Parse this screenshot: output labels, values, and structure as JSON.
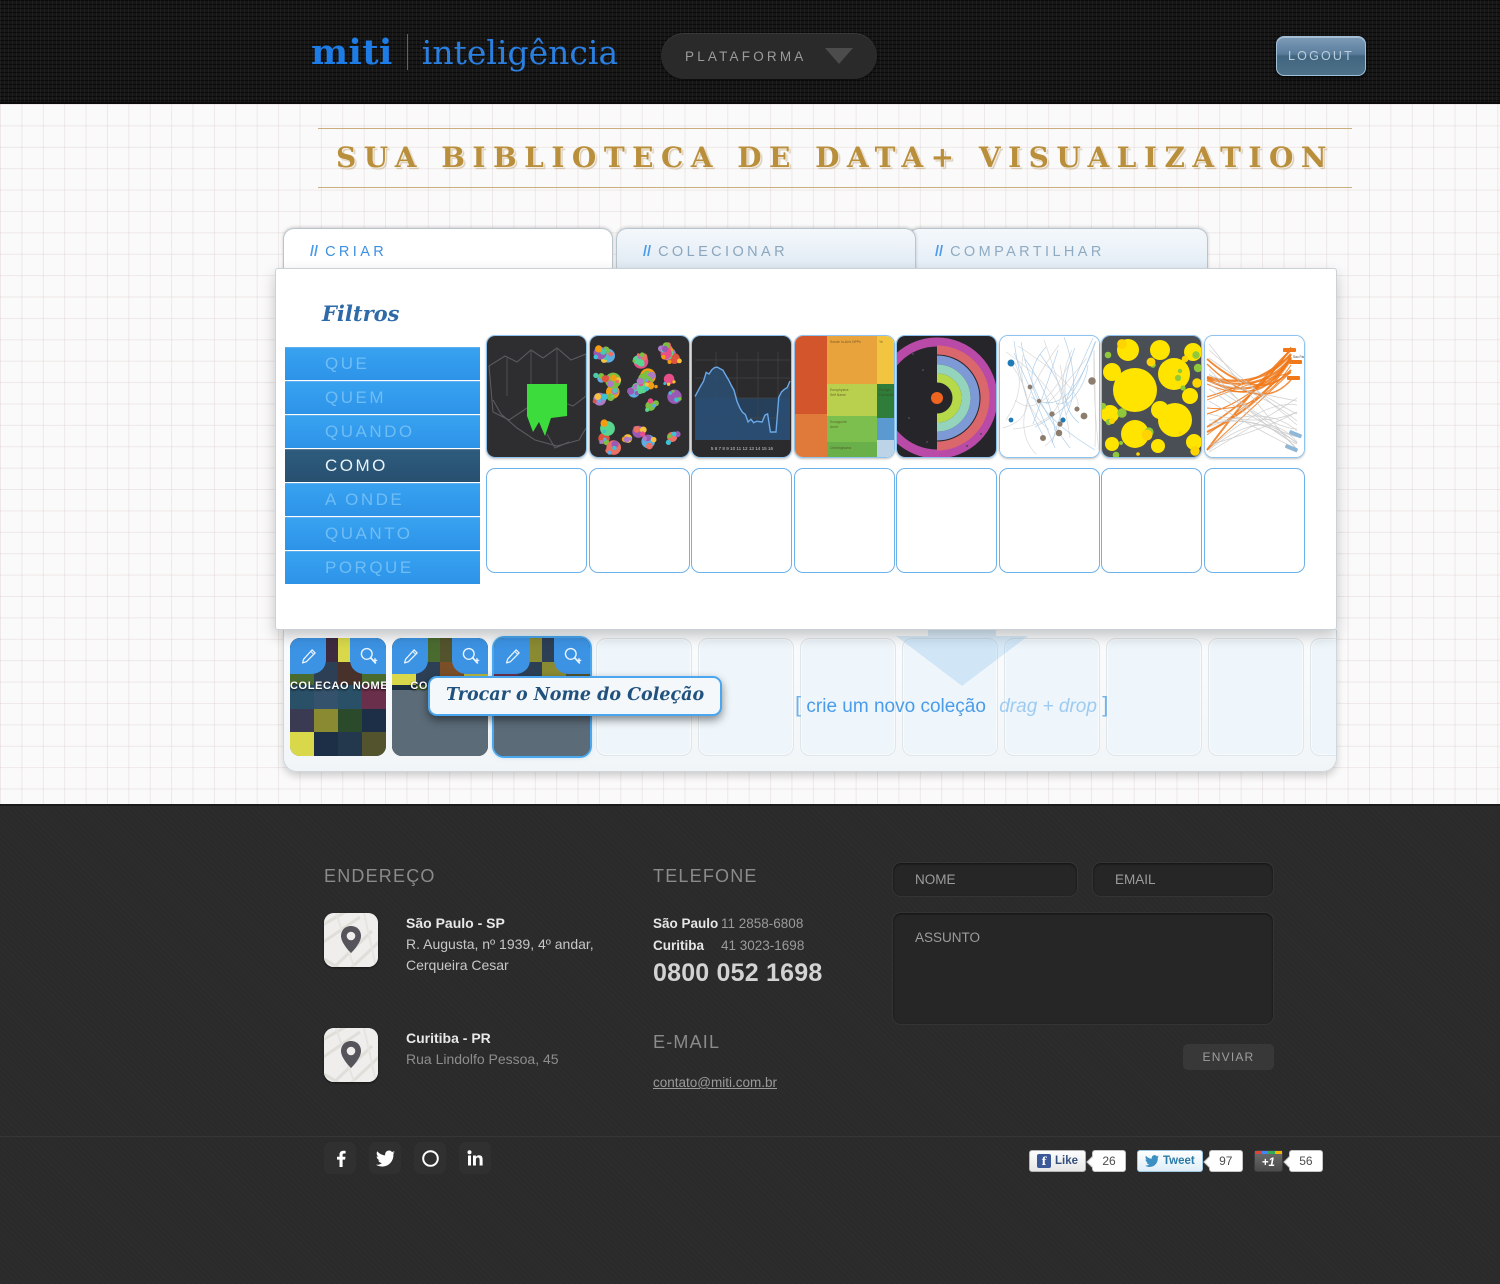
{
  "header": {
    "logo_main": "miti",
    "logo_sub": "inteligência",
    "platform_label": "PLATAFORMA",
    "platform_caret": "chevron-down-icon",
    "logout_label": "LOGOUT"
  },
  "tagline": "SUA BIBLIOTECA DE DATA+ VISUALIZATION",
  "tabs": [
    {
      "slashes": "//",
      "label": "CRIAR",
      "active": true
    },
    {
      "slashes": "//",
      "label": "COLECIONAR",
      "active": false
    },
    {
      "slashes": "//",
      "label": "COMPARTILHAR",
      "active": false
    }
  ],
  "panel": {
    "filters_title": "Filtros",
    "filters": [
      {
        "label": "QUE",
        "active": false
      },
      {
        "label": "QUEM",
        "active": false
      },
      {
        "label": "QUANDO",
        "active": false
      },
      {
        "label": "COMO",
        "active": true
      },
      {
        "label": "A ONDE",
        "active": false
      },
      {
        "label": "QUANTO",
        "active": false
      },
      {
        "label": "PORQUE",
        "active": false
      }
    ],
    "thumbnails": [
      {
        "name": "choropleth-map-australia",
        "kind": "map"
      },
      {
        "name": "bubble-cluster-chart",
        "kind": "bubbles"
      },
      {
        "name": "area-line-chart",
        "kind": "area"
      },
      {
        "name": "treemap-chart",
        "kind": "treemap"
      },
      {
        "name": "radial-sunburst-chart",
        "kind": "radial"
      },
      {
        "name": "network-arc-graph",
        "kind": "network"
      },
      {
        "name": "circle-packing-yellow",
        "kind": "packing"
      },
      {
        "name": "chord-arc-diagram",
        "kind": "chord"
      }
    ],
    "empty_slots": 8
  },
  "collections": {
    "tiles": [
      {
        "name": "COLECAO NOME",
        "filled": true,
        "selected": false
      },
      {
        "name": "COLECAO",
        "filled": true,
        "selected": false
      },
      {
        "name": "",
        "filled": true,
        "selected": true
      }
    ],
    "empty_tiles": 8,
    "edit_icon": "pencil-icon",
    "zoom_icon": "magnifier-plus-icon",
    "hint_open": "[",
    "hint_text": "crie um novo coleção",
    "hint_drag": "drag + drop",
    "hint_close": "]",
    "tooltip": "Trocar o Nome do Coleção",
    "arrow_icon": "arrow-down-icon"
  },
  "footer": {
    "address": {
      "heading": "ENDEREÇO",
      "entries": [
        {
          "icon": "map-pin-icon",
          "city": "São Paulo - SP",
          "line1": "R. Augusta, nº 1939, 4º andar,",
          "line2": "Cerqueira Cesar"
        },
        {
          "icon": "map-pin-icon",
          "city": "Curitiba - PR",
          "line1": "Rua Lindolfo Pessoa, 45",
          "line2": ""
        }
      ]
    },
    "phone": {
      "heading": "TELEFONE",
      "rows": [
        {
          "city": "São Paulo",
          "number": "11 2858-6808"
        },
        {
          "city": "Curitiba",
          "number": "41 3023-1698"
        }
      ],
      "toll_free": "0800 052 1698",
      "email_heading": "E-MAIL",
      "email": "contato@miti.com.br"
    },
    "form": {
      "name_placeholder": "NOME",
      "email_placeholder": "EMAIL",
      "subject_placeholder": "ASSUNTO",
      "send_label": "ENVIAR",
      "name_value": "",
      "email_value": "",
      "subject_value": ""
    },
    "social": [
      {
        "name": "facebook-icon",
        "glyph": "f"
      },
      {
        "name": "twitter-icon",
        "glyph": "t"
      },
      {
        "name": "circle-icon",
        "glyph": "o"
      },
      {
        "name": "linkedin-icon",
        "glyph": "in"
      }
    ],
    "share": {
      "facebook_label": "Like",
      "facebook_count": "26",
      "twitter_label": "Tweet",
      "twitter_count": "97",
      "gplus_label": "+1",
      "gplus_count": "56"
    }
  },
  "colors": {
    "brand_blue": "#2a7fe0",
    "filter_blue": "#2d93e8",
    "filter_active": "#2e5b7d",
    "gold": "#b98f3c",
    "footer_bg": "#2a2a2a"
  }
}
